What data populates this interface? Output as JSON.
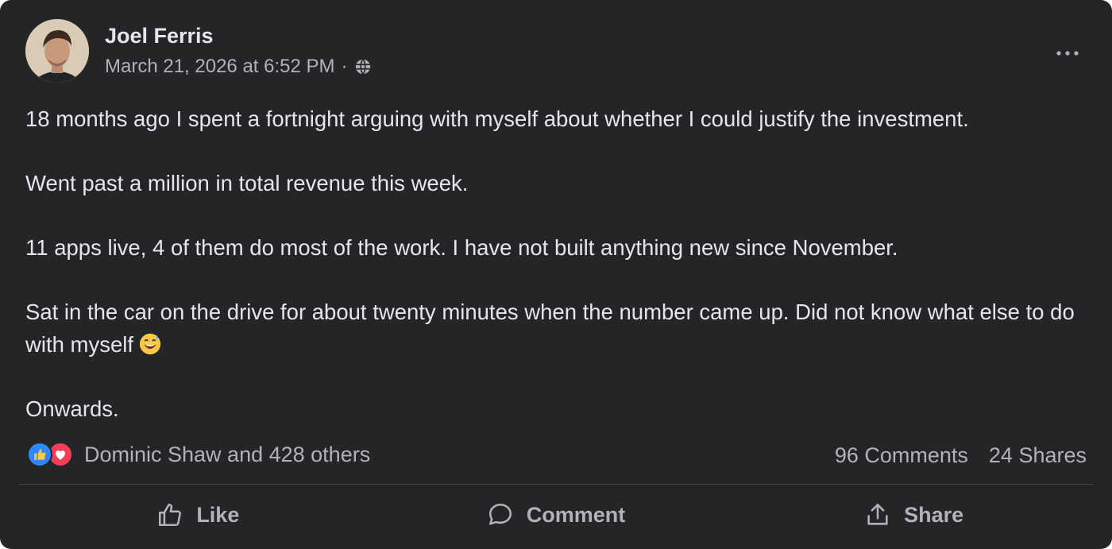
{
  "post": {
    "author": "Joel Ferris",
    "timestamp": "March 21, 2026 at 6:52 PM",
    "separator": "·",
    "privacy_icon": "globe-icon",
    "more_icon": "more-options-icon",
    "paragraphs": [
      "18 months ago I spent a fortnight arguing with myself about whether I could justify the investment.",
      "Went past a million in total revenue this week.",
      "11 apps live, 4 of them do most of the work. I have not built anything new since November."
    ],
    "paragraph_4": "Sat in the car on the drive for about twenty minutes when the number came up. Did not know what else to do with myself",
    "paragraph_4_emoji": "grinning-sweat-emoji",
    "paragraph_5": "Onwards."
  },
  "engagement": {
    "reaction_icons": [
      "like-reaction-icon",
      "love-reaction-icon"
    ],
    "reactions_text": "Dominic Shaw and 428 others",
    "comments": "96 Comments",
    "shares": "24 Shares"
  },
  "actions": {
    "like": "Like",
    "comment": "Comment",
    "share": "Share"
  },
  "colors": {
    "card_bg": "#242526",
    "text_primary": "#e4e6eb",
    "text_secondary": "#b0b3b8",
    "like_blue": "#2d88ff",
    "love_red": "#f33e58"
  }
}
